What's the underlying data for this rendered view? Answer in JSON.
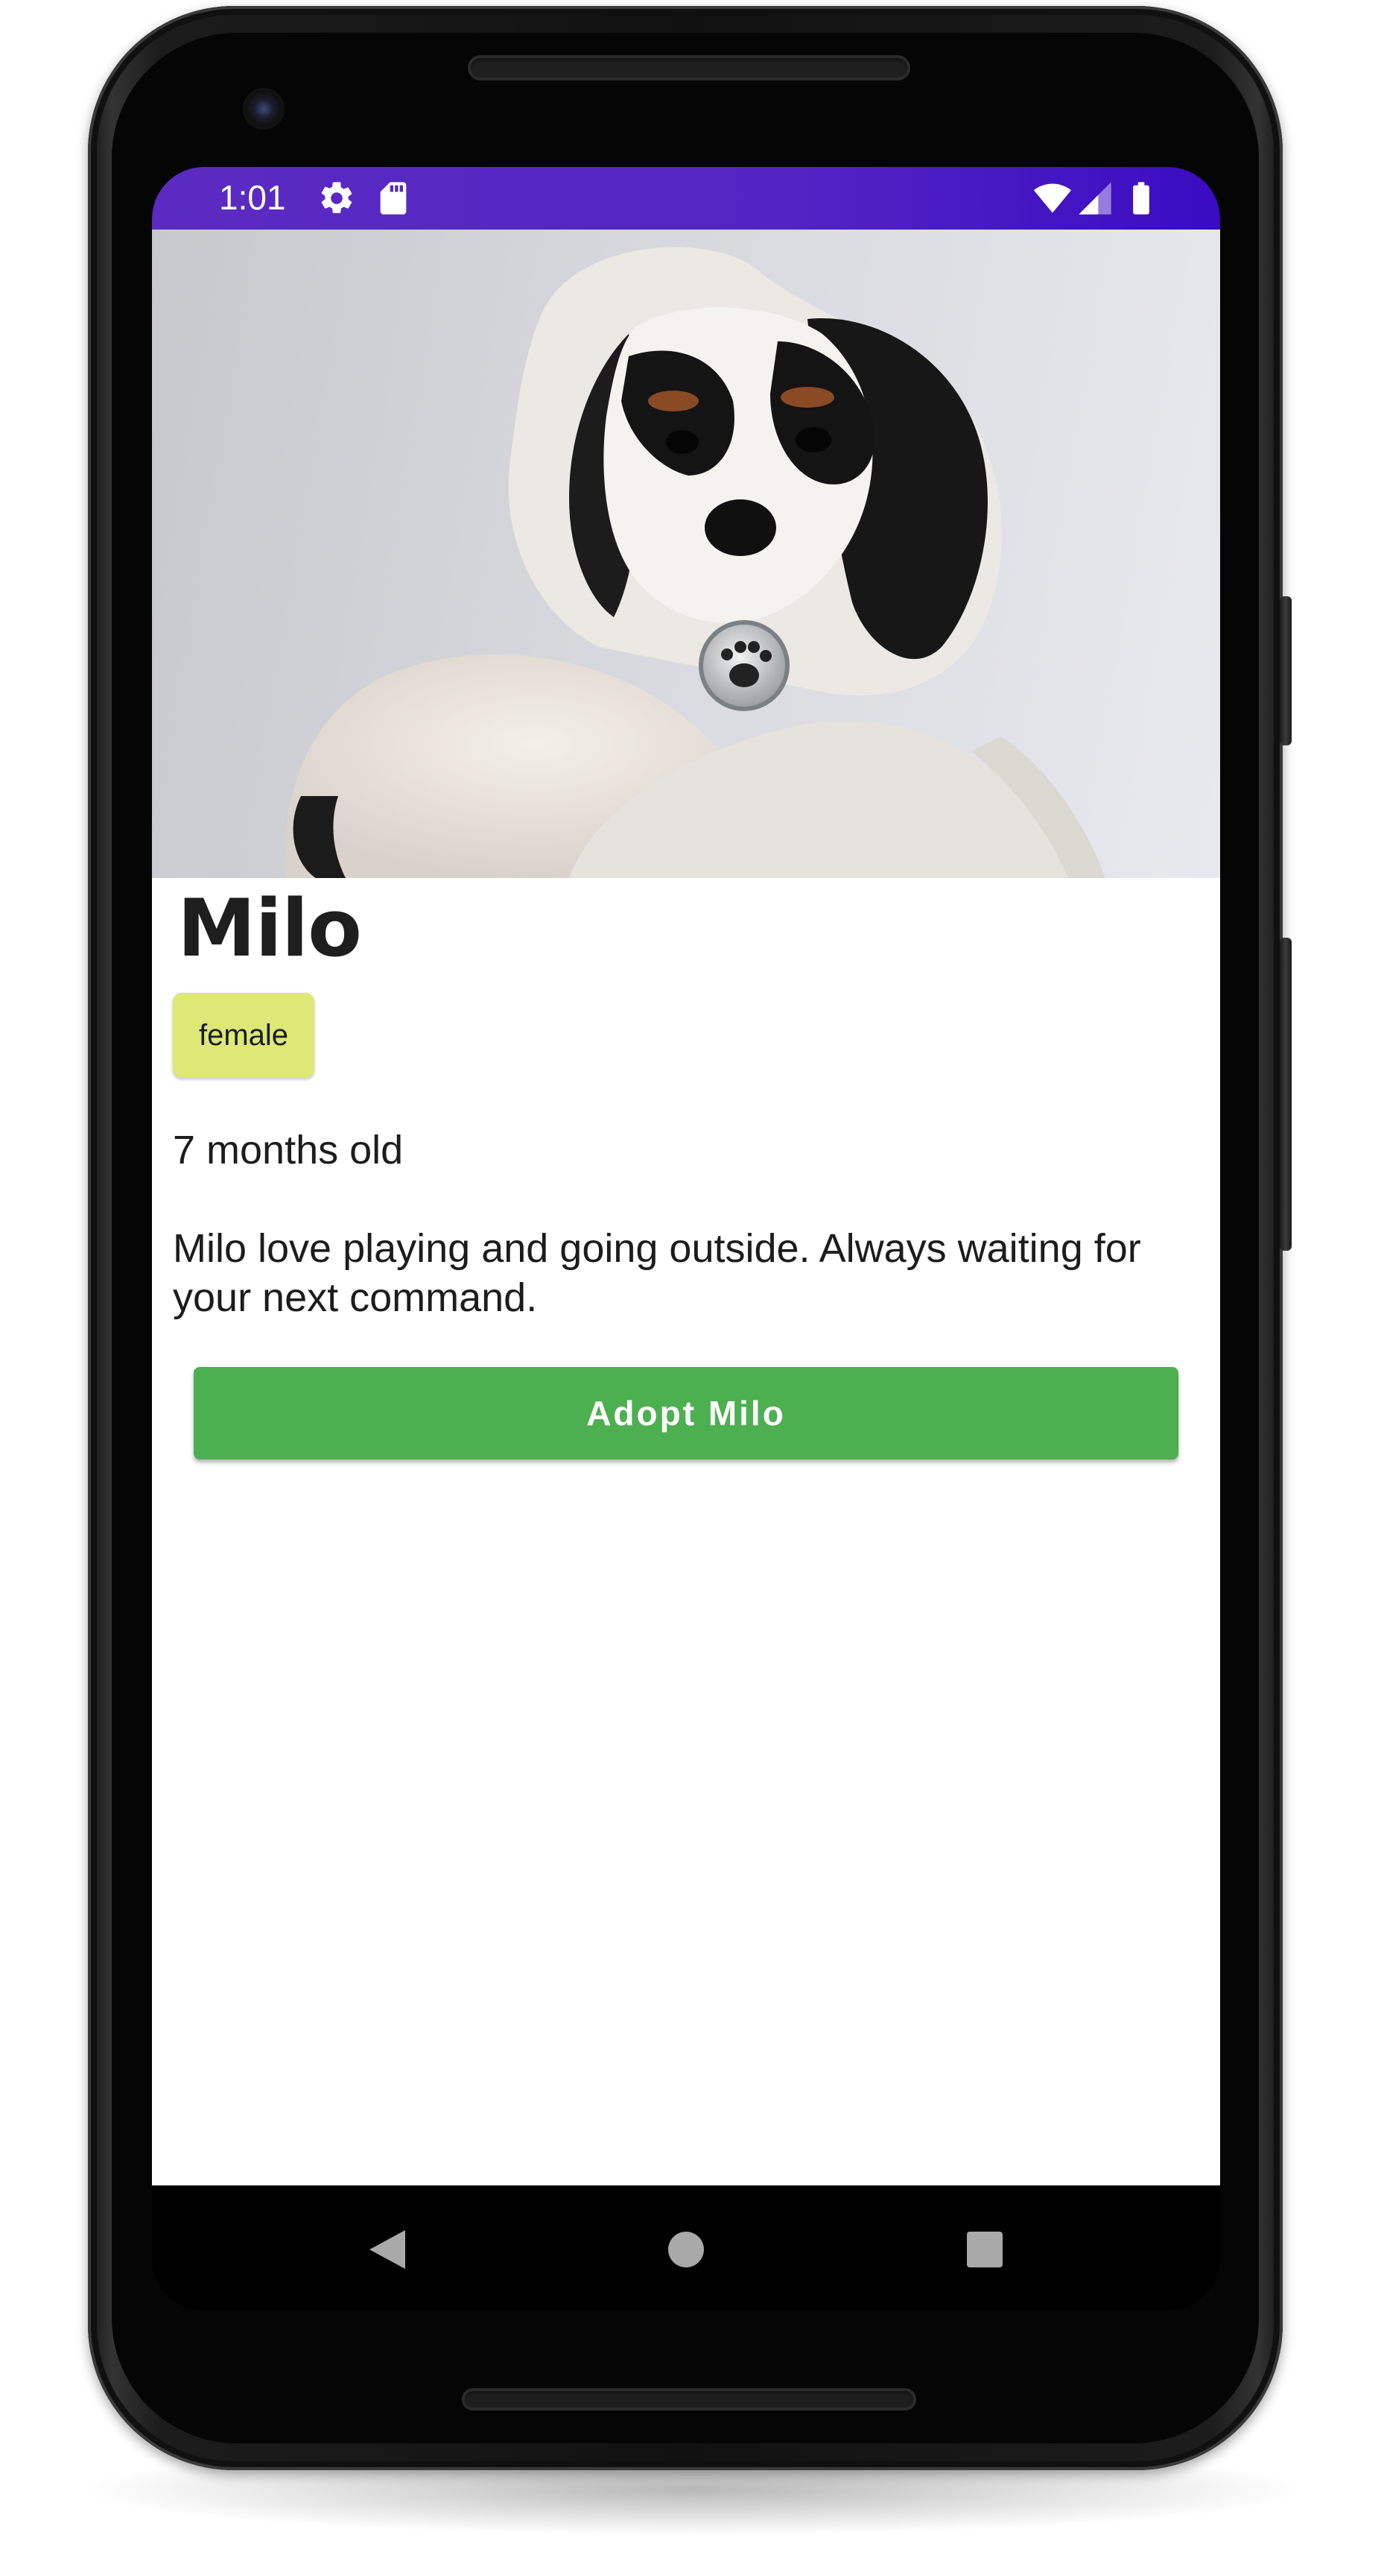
{
  "status_bar": {
    "time": "1:01",
    "icons": [
      "settings-icon",
      "sd-card-icon",
      "wifi-icon",
      "cellular-signal-icon",
      "battery-icon"
    ],
    "background_color": "#5224c3"
  },
  "pet": {
    "name": "Milo",
    "gender": "female",
    "age": "7 months old",
    "description": "Milo love playing and going outside. Always waiting for your next command.",
    "photo_subject": "puppy-in-white-hoodie"
  },
  "actions": {
    "adopt_label": "Adopt Milo",
    "adopt_color": "#4caf50"
  },
  "colors": {
    "chip": "#dde876",
    "status_bar_accent": "#3a0cc2"
  },
  "nav_bar": {
    "items": [
      "back-icon",
      "home-icon",
      "recents-icon"
    ]
  }
}
